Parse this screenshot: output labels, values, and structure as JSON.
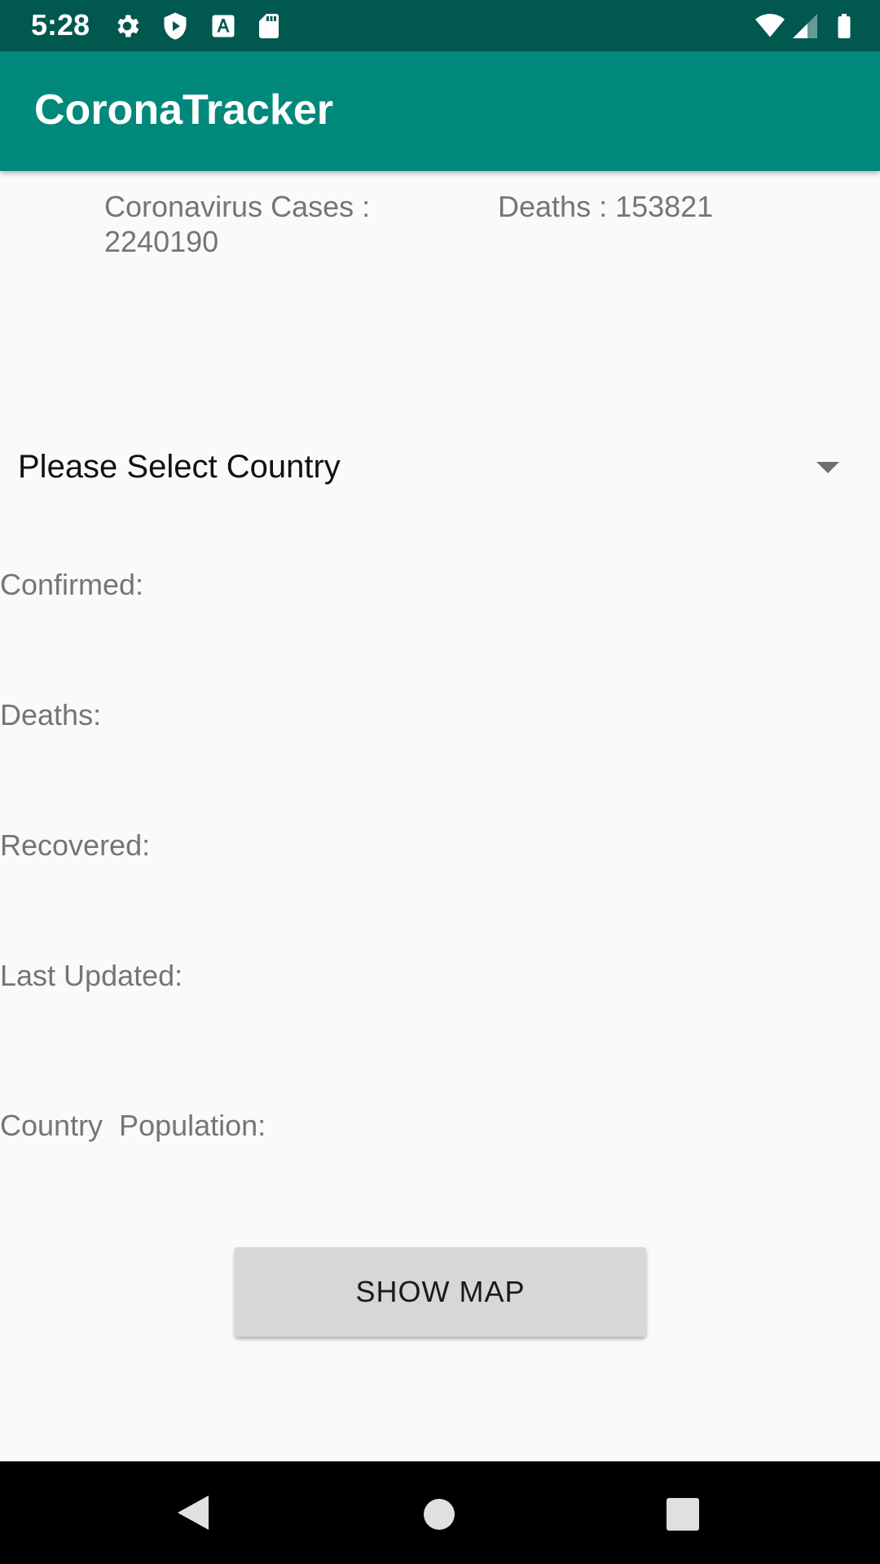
{
  "status_bar": {
    "time": "5:28",
    "icons_left": [
      "gear-icon",
      "shield-play-icon",
      "font-a-icon",
      "sd-card-icon"
    ],
    "icons_right": [
      "wifi-icon",
      "signal-icon",
      "battery-icon"
    ]
  },
  "app_bar": {
    "title": "CoronaTracker"
  },
  "summary": {
    "cases_label": "Coronavirus Cases :",
    "cases_value": "2240190",
    "deaths_text": "Deaths : 153821"
  },
  "country_select": {
    "selected": "Please Select Country"
  },
  "info": {
    "confirmed": "Confirmed:",
    "deaths": "Deaths:",
    "recovered": "Recovered:",
    "last_updated": "Last Updated:",
    "population": "Country  Population:"
  },
  "show_map_button": "SHOW MAP",
  "nav_bar": {
    "buttons": [
      "back-icon",
      "home-icon",
      "recents-icon"
    ]
  },
  "colors": {
    "status_bar": "#00584f",
    "app_bar": "#00897b",
    "background": "#fafafa",
    "label_text": "#757575",
    "button": "#d6d7d7"
  }
}
